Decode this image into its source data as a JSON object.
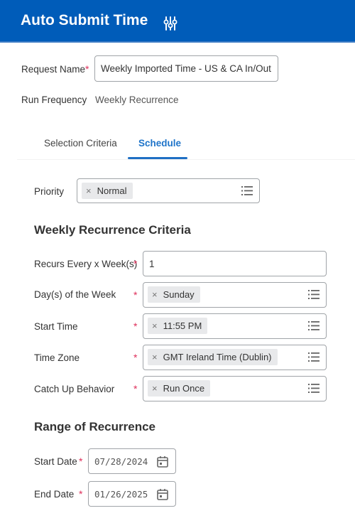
{
  "header": {
    "title": "Auto Submit Time",
    "icon": "sliders-icon"
  },
  "request": {
    "name_label": "Request Name",
    "name_value": "Weekly Imported Time - US & CA In/Out",
    "required_marker": "*",
    "frequency_label": "Run Frequency",
    "frequency_value": "Weekly Recurrence"
  },
  "tabs": [
    {
      "label": "Selection Criteria",
      "active": false
    },
    {
      "label": "Schedule",
      "active": true
    }
  ],
  "schedule": {
    "priority": {
      "label": "Priority",
      "value": "Normal",
      "remove_icon": "×"
    },
    "weekly_section_title": "Weekly Recurrence Criteria",
    "fields": [
      {
        "label": "Recurs Every x Week(s)",
        "type": "text",
        "value": "1"
      },
      {
        "label": "Day(s) of the Week",
        "type": "prompt",
        "value": "Sunday"
      },
      {
        "label": "Start Time",
        "type": "prompt",
        "value": "11:55 PM"
      },
      {
        "label": "Time Zone",
        "type": "prompt",
        "value": "GMT Ireland Time (Dublin)"
      },
      {
        "label": "Catch Up Behavior",
        "type": "prompt",
        "value": "Run Once"
      }
    ],
    "range_section_title": "Range of Recurrence",
    "start_date": {
      "label": "Start Date",
      "value": "07/28/2024"
    },
    "end_date": {
      "label": "End Date",
      "value": "01/26/2025"
    }
  },
  "colors": {
    "header_bg": "#005cb9",
    "active_tab": "#1f74c9",
    "required": "#de2e5a"
  }
}
